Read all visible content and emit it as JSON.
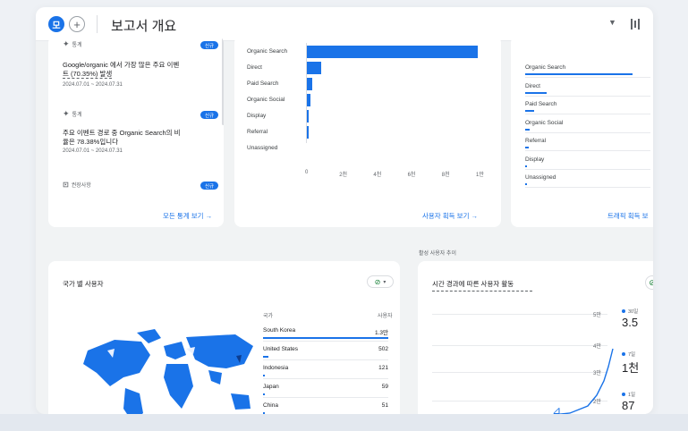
{
  "header": {
    "segment_label": "모",
    "add_label": "+",
    "title": "보고서 개요",
    "dropdown_icon": "caret-down-icon",
    "compare_icon": "compare-icon"
  },
  "insights": {
    "items": [
      {
        "kind": "통계",
        "badge": "신규",
        "text_a": "Google/organic 에서 가장 많은 주요 이벤",
        "text_b": "트 (70.35%) 발생",
        "date": "2024.07.01 ~ 2024.07.31"
      },
      {
        "kind": "통계",
        "badge": "신규",
        "text_a": "주요 이벤트 경로 중 Organic Search의 비",
        "text_b": "율은 78.38%입니다",
        "date": "2024.07.01 ~ 2024.07.31"
      }
    ],
    "recommend_label": "권장사항",
    "recommend_badge": "신규",
    "view_all": "모든 통계 보기 →"
  },
  "acquisition": {
    "link": "사용자 획득 보기 →"
  },
  "chart_data": {
    "type": "bar",
    "orientation": "horizontal",
    "categories": [
      "Organic Search",
      "Direct",
      "Paid Search",
      "Organic Social",
      "Display",
      "Referral",
      "Unassigned"
    ],
    "values": [
      10000,
      850,
      300,
      220,
      90,
      60,
      0
    ],
    "xticks": [
      "0",
      "2천",
      "4천",
      "6천",
      "8천",
      "1만"
    ],
    "xlim": [
      0,
      10000
    ]
  },
  "channels": {
    "items": [
      "Organic Search",
      "Direct",
      "Paid Search",
      "Organic Social",
      "Referral",
      "Display",
      "Unassigned"
    ],
    "share": [
      1.0,
      0.2,
      0.08,
      0.04,
      0.03,
      0.02,
      0.0
    ],
    "link": "트래픽 획득 보"
  },
  "country": {
    "title": "국가 별 사용자",
    "col_country": "국가",
    "col_users": "사용자",
    "rows": [
      {
        "name": "South Korea",
        "value": "1.3만"
      },
      {
        "name": "United States",
        "value": "502"
      },
      {
        "name": "Indonesia",
        "value": "121"
      },
      {
        "name": "Japan",
        "value": "59"
      },
      {
        "name": "China",
        "value": "51"
      }
    ],
    "share": [
      1.0,
      0.04,
      0.01,
      0.005,
      0.004
    ]
  },
  "realtime": {
    "label": "활성 사용자 추이"
  },
  "timecard": {
    "title": "시간 경과에 따른 사용자 활동",
    "yticks": [
      "5만",
      "4만",
      "3만",
      "2만"
    ],
    "legend": [
      {
        "period": "30일",
        "value": "3.5"
      },
      {
        "period": "7일",
        "value": "1천"
      },
      {
        "period": "1일",
        "value": "87"
      }
    ]
  }
}
